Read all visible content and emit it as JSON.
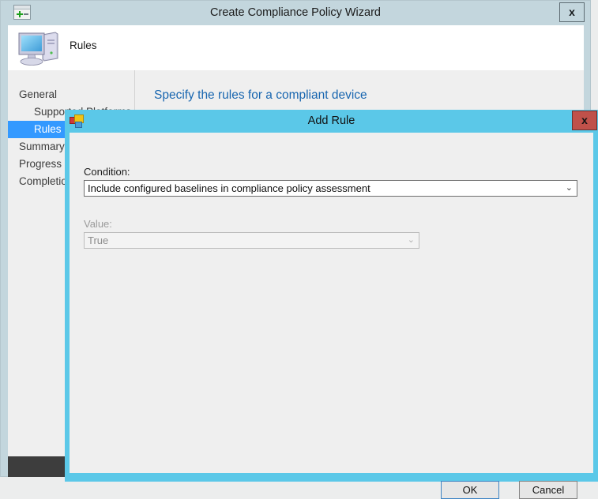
{
  "wizard": {
    "title": "Create Compliance Policy Wizard",
    "window_icon": "wizard-window-icon",
    "close_label": "x",
    "header": {
      "icon": "computer-monitor-icon",
      "label": "Rules"
    },
    "sidebar": {
      "items": [
        {
          "label": "General",
          "indented": false,
          "selected": false
        },
        {
          "label": "Supported Platforms",
          "indented": true,
          "selected": false
        },
        {
          "label": "Rules",
          "indented": true,
          "selected": true
        },
        {
          "label": "Summary",
          "indented": false,
          "selected": false
        },
        {
          "label": "Progress",
          "indented": false,
          "selected": false
        },
        {
          "label": "Completion",
          "indented": false,
          "selected": false
        }
      ]
    },
    "content": {
      "heading": "Specify the rules for a compliant device"
    }
  },
  "dialog": {
    "title": "Add Rule",
    "window_icon": "add-rule-window-icon",
    "close_label": "x",
    "condition": {
      "label": "Condition:",
      "value": "Include configured baselines in compliance policy assessment",
      "arrow": "⌄",
      "disabled": false
    },
    "value": {
      "label": "Value:",
      "value": "True",
      "arrow": "⌄",
      "disabled": true
    },
    "buttons": {
      "ok": "OK",
      "cancel": "Cancel"
    }
  },
  "colors": {
    "wizard_titlebar": "#c3d6dd",
    "dialog_titlebar": "#5bc8e8",
    "dialog_close": "#c0514a",
    "selection": "#3399ff",
    "heading": "#1866b0",
    "footer": "#3d3d3d"
  }
}
